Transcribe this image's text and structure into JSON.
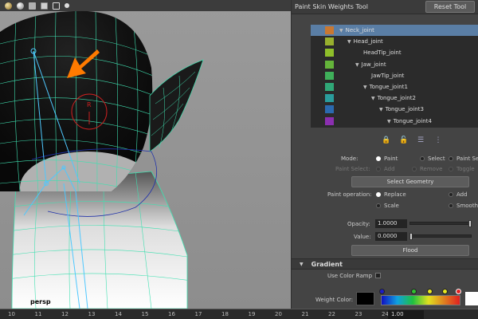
{
  "viewport": {
    "camera_label": "persp",
    "toolbar_icons": [
      "shading-sphere-icon",
      "light-sphere-icon",
      "texture-icon",
      "cube-icon",
      "wireframe-cube-icon",
      "isolate-icon"
    ]
  },
  "panel": {
    "title": "Paint Skin Weights Tool",
    "reset_label": "Reset Tool",
    "joints": [
      {
        "name": "Neck_joint",
        "color": "#c87832",
        "depth": 0,
        "arrow": true,
        "selected": true
      },
      {
        "name": "Head_joint",
        "color": "#98b02e",
        "depth": 1,
        "arrow": true
      },
      {
        "name": "HeadTip_joint",
        "color": "#8fbf2a",
        "depth": 2,
        "arrow": false
      },
      {
        "name": "Jaw_joint",
        "color": "#64b43a",
        "depth": 2,
        "arrow": true
      },
      {
        "name": "JawTip_joint",
        "color": "#3fb05a",
        "depth": 3,
        "arrow": false
      },
      {
        "name": "Tongue_joint1",
        "color": "#30a878",
        "depth": 3,
        "arrow": true
      },
      {
        "name": "Tongue_joint2",
        "color": "#2a9c9c",
        "depth": 4,
        "arrow": true
      },
      {
        "name": "Tongue_joint3",
        "color": "#2b6ab0",
        "depth": 5,
        "arrow": true
      },
      {
        "name": "Tongue_joint4",
        "color": "#8b2fb0",
        "depth": 6,
        "arrow": true
      }
    ],
    "mode": {
      "label": "Mode:",
      "options": [
        "Paint",
        "Select",
        "Paint Se"
      ],
      "selected": "Paint"
    },
    "paint_select": {
      "label": "Paint Select:",
      "options": [
        "Add",
        "Remove",
        "Toggle"
      ]
    },
    "select_geometry_label": "Select Geometry",
    "paint_operation": {
      "label": "Paint operation:",
      "options": [
        "Replace",
        "Add",
        "Scale",
        "Smooth"
      ],
      "selected": "Replace"
    },
    "opacity": {
      "label": "Opacity:",
      "value": "1.0000",
      "level": 1.0
    },
    "value": {
      "label": "Value:",
      "value": "0.0000",
      "level": 0.0
    },
    "flood_label": "Flood",
    "gradient": {
      "title": "Gradient",
      "use_color_ramp_label": "Use Color Ramp",
      "weight_color_label": "Weight Color:"
    }
  },
  "timeline": {
    "ticks": [
      "10",
      "11",
      "12",
      "13",
      "14",
      "15",
      "16",
      "17",
      "18",
      "19",
      "20",
      "21",
      "22",
      "23",
      "24"
    ],
    "current_frame": "1.00"
  }
}
